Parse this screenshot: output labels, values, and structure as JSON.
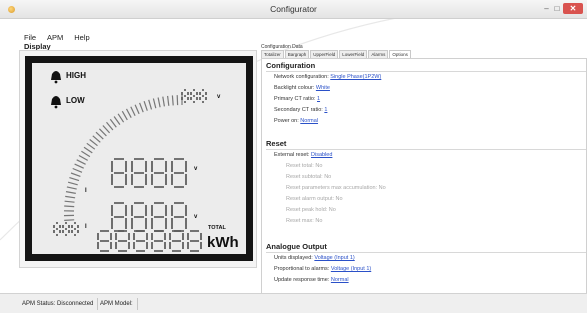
{
  "window": {
    "title": "Configurator",
    "buttons": {
      "minimize": "–",
      "maximize": "□",
      "close": "✕"
    }
  },
  "menu": {
    "items": [
      "File",
      "APM",
      "Help"
    ]
  },
  "display": {
    "title": "Display",
    "labels": {
      "high": "HIGH",
      "low": "LOW",
      "volt": "V",
      "v": "v",
      "i": "I",
      "total": "TOTAL",
      "kwh": "kWh"
    }
  },
  "config_data": {
    "caption": "Configuration Data",
    "tabs": [
      "Totalizer",
      "Bargraph",
      "UpperField",
      "LowerField",
      "Alarms",
      "Options"
    ],
    "active_tab": "Options"
  },
  "sections": {
    "configuration": {
      "title": "Configuration",
      "rows": [
        {
          "label": "Network configuration: ",
          "value": "Single Phase(1P2W)"
        },
        {
          "label": "Backlight colour: ",
          "value": "White"
        },
        {
          "label": "Primary CT ratio: ",
          "value": "1"
        },
        {
          "label": "Secondary CT ratio: ",
          "value": "1"
        },
        {
          "label": "Power on: ",
          "value": "Normal"
        }
      ]
    },
    "reset": {
      "title": "Reset",
      "external": {
        "label": "External reset: ",
        "value": "Disabled"
      },
      "rows": [
        "Reset total: No",
        "Reset subtotal: No",
        "Reset parameters max accumulation: No",
        "Reset alarm output: No",
        "Reset peak hold: No",
        "Reset max: No"
      ]
    },
    "analogue": {
      "title": "Analogue Output",
      "rows": [
        {
          "label": "Units displayed: ",
          "value": "Voltage (Input 1)"
        },
        {
          "label": "Proportional to alarms: ",
          "value": "Voltage (Input 1)"
        },
        {
          "label": "Update response time: ",
          "value": "Normal"
        }
      ]
    }
  },
  "status": {
    "connection": "APM Status: Disconnected",
    "model": "APM Model:"
  },
  "colors": {
    "link": "#2a50c8",
    "lcd_bezel": "#141414",
    "lcd_face": "#ececec",
    "close_button": "#d9534f"
  }
}
